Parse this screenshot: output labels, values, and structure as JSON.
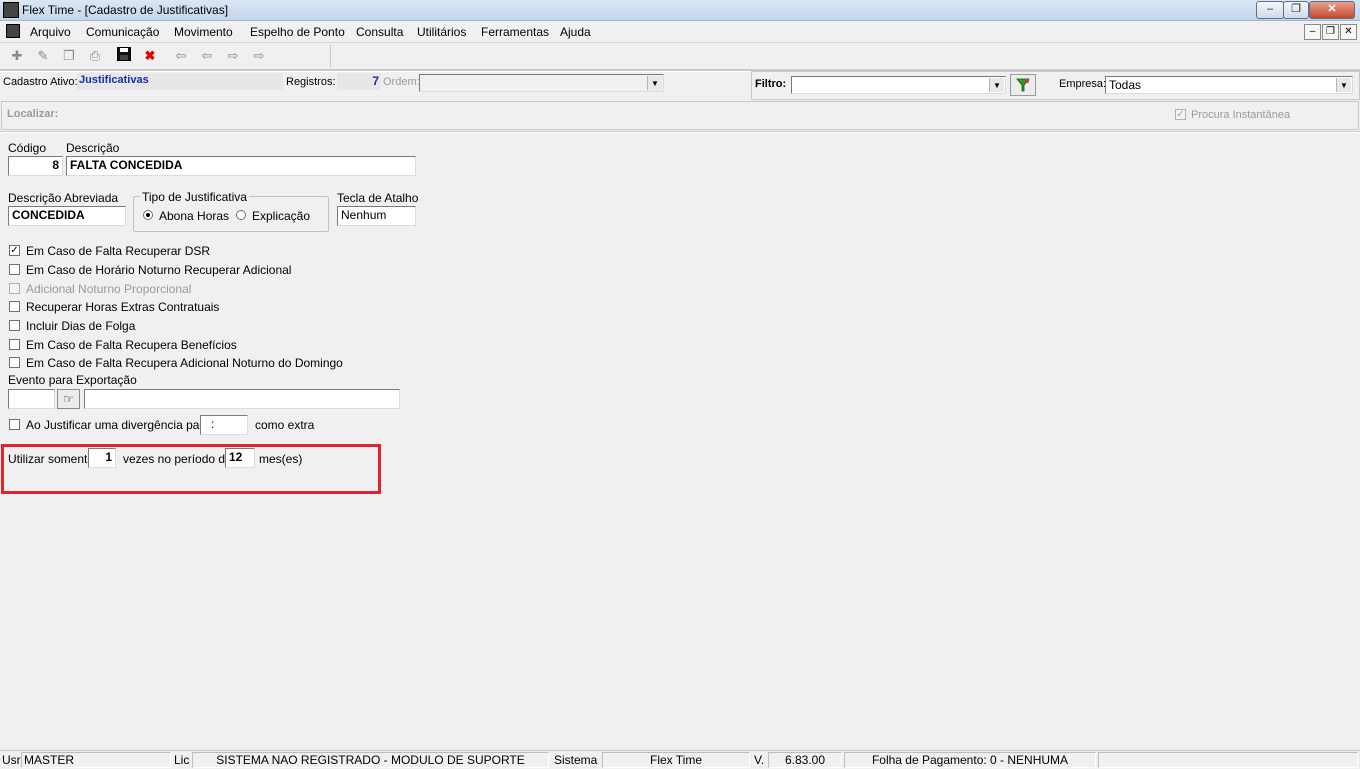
{
  "window": {
    "title": "Flex Time - [Cadastro de Justificativas]"
  },
  "menu": [
    "Arquivo",
    "Comunicação",
    "Movimento",
    "Espelho de Ponto",
    "Consulta",
    "Utilitários",
    "Ferramentas",
    "Ajuda"
  ],
  "toolbar_icons": [
    "new-record-icon",
    "edit-record-icon",
    "copy-record-icon",
    "print-icon",
    "save-icon",
    "delete-icon",
    "first-record-icon",
    "previous-record-icon",
    "next-record-icon",
    "last-record-icon"
  ],
  "info": {
    "cadastro_label": "Cadastro Ativo:",
    "cadastro_value": "Justificativas",
    "registros_label": "Registros:",
    "registros_value": "7",
    "ordem_label": "Ordem:",
    "ordem_value": "",
    "filtro_label": "Filtro:",
    "filtro_value": "",
    "empresa_label": "Empresa:",
    "empresa_value": "Todas"
  },
  "search": {
    "localizar_label": "Localizar:",
    "procura_label": "Procura Instantânea",
    "procura_checked": true
  },
  "form": {
    "codigo_label": "Código",
    "codigo_value": "8",
    "descricao_label": "Descrição",
    "descricao_value": "FALTA CONCEDIDA",
    "desc_abrev_label": "Descrição Abreviada",
    "desc_abrev_value": "CONCEDIDA",
    "tipo_label": "Tipo de Justificativa",
    "tipo_opt1": "Abona Horas",
    "tipo_opt2": "Explicação",
    "tipo_selected": "Abona Horas",
    "tecla_label": "Tecla de Atalho",
    "tecla_value": "Nenhum",
    "checkboxes": [
      {
        "label": "Em Caso de Falta Recuperar DSR",
        "checked": true,
        "enabled": true
      },
      {
        "label": "Em Caso de Horário Noturno Recuperar Adicional",
        "checked": false,
        "enabled": true
      },
      {
        "label": "Adicional Noturno Proporcional",
        "checked": false,
        "enabled": false
      },
      {
        "label": "Recuperar Horas Extras Contratuais",
        "checked": false,
        "enabled": true
      },
      {
        "label": "Incluir Dias de Folga",
        "checked": false,
        "enabled": true
      },
      {
        "label": "Em Caso de Falta Recupera Benefícios",
        "checked": false,
        "enabled": true
      },
      {
        "label": "Em Caso de Falta Recupera Adicional Noturno do Domingo",
        "checked": false,
        "enabled": true
      }
    ],
    "evento_label": "Evento para Exportação",
    "evento_code": "",
    "evento_desc": "",
    "divergencia_label": "Ao Justificar uma divergência pagar",
    "divergencia_value": ":",
    "divergencia_suffix": "como extra",
    "utilizar_label": "Utilizar somente",
    "utilizar_value": "1",
    "vezes_label": "vezes no período de",
    "periodo_value": "12",
    "meses_label": "mes(es)"
  },
  "highlight_color": "#e4222e",
  "status": {
    "usr_label": "Usr",
    "usr_value": "MASTER",
    "lic_label": "Lic",
    "lic_value": "SISTEMA NAO REGISTRADO - MODULO DE SUPORTE",
    "sistema_label": "Sistema",
    "sistema_value": "Flex Time",
    "versao_label": "V.",
    "versao_value": "6.83.00",
    "folha_value": "Folha de Pagamento: 0 - NENHUMA"
  }
}
